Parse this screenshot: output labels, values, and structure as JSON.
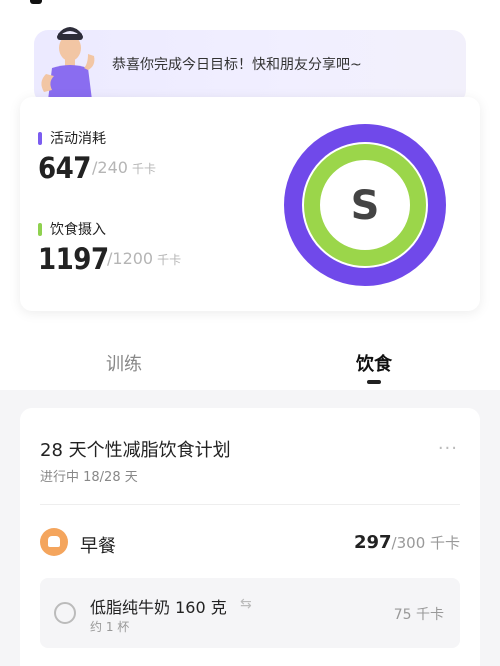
{
  "banner": {
    "message": "恭喜你完成今日目标！快和朋友分享吧~"
  },
  "summary": {
    "activity": {
      "label": "活动消耗",
      "value": "647",
      "target": "/240",
      "unit": "千卡",
      "color": "#7b5cf0"
    },
    "diet": {
      "label": "饮食摄入",
      "value": "1197",
      "target": "/1200",
      "unit": "千卡",
      "color": "#8fd14f"
    },
    "ring": {
      "grade": "S",
      "outer_color": "#7049ea",
      "inner_color": "#9bd64a"
    }
  },
  "tabs": [
    {
      "label": "训练",
      "active": false
    },
    {
      "label": "饮食",
      "active": true
    }
  ],
  "plan": {
    "title": "28 天个性减脂饮食计划",
    "progress": "进行中 18/28 天",
    "more_icon": "···",
    "meal": {
      "name": "早餐",
      "kcal": "297",
      "target": "/300 千卡",
      "icon": "bread-icon"
    },
    "food": {
      "name": "低脂纯牛奶 160 克",
      "amount": "约 1 杯",
      "kcal": "75 千卡",
      "swap_icon": "⇆"
    }
  }
}
